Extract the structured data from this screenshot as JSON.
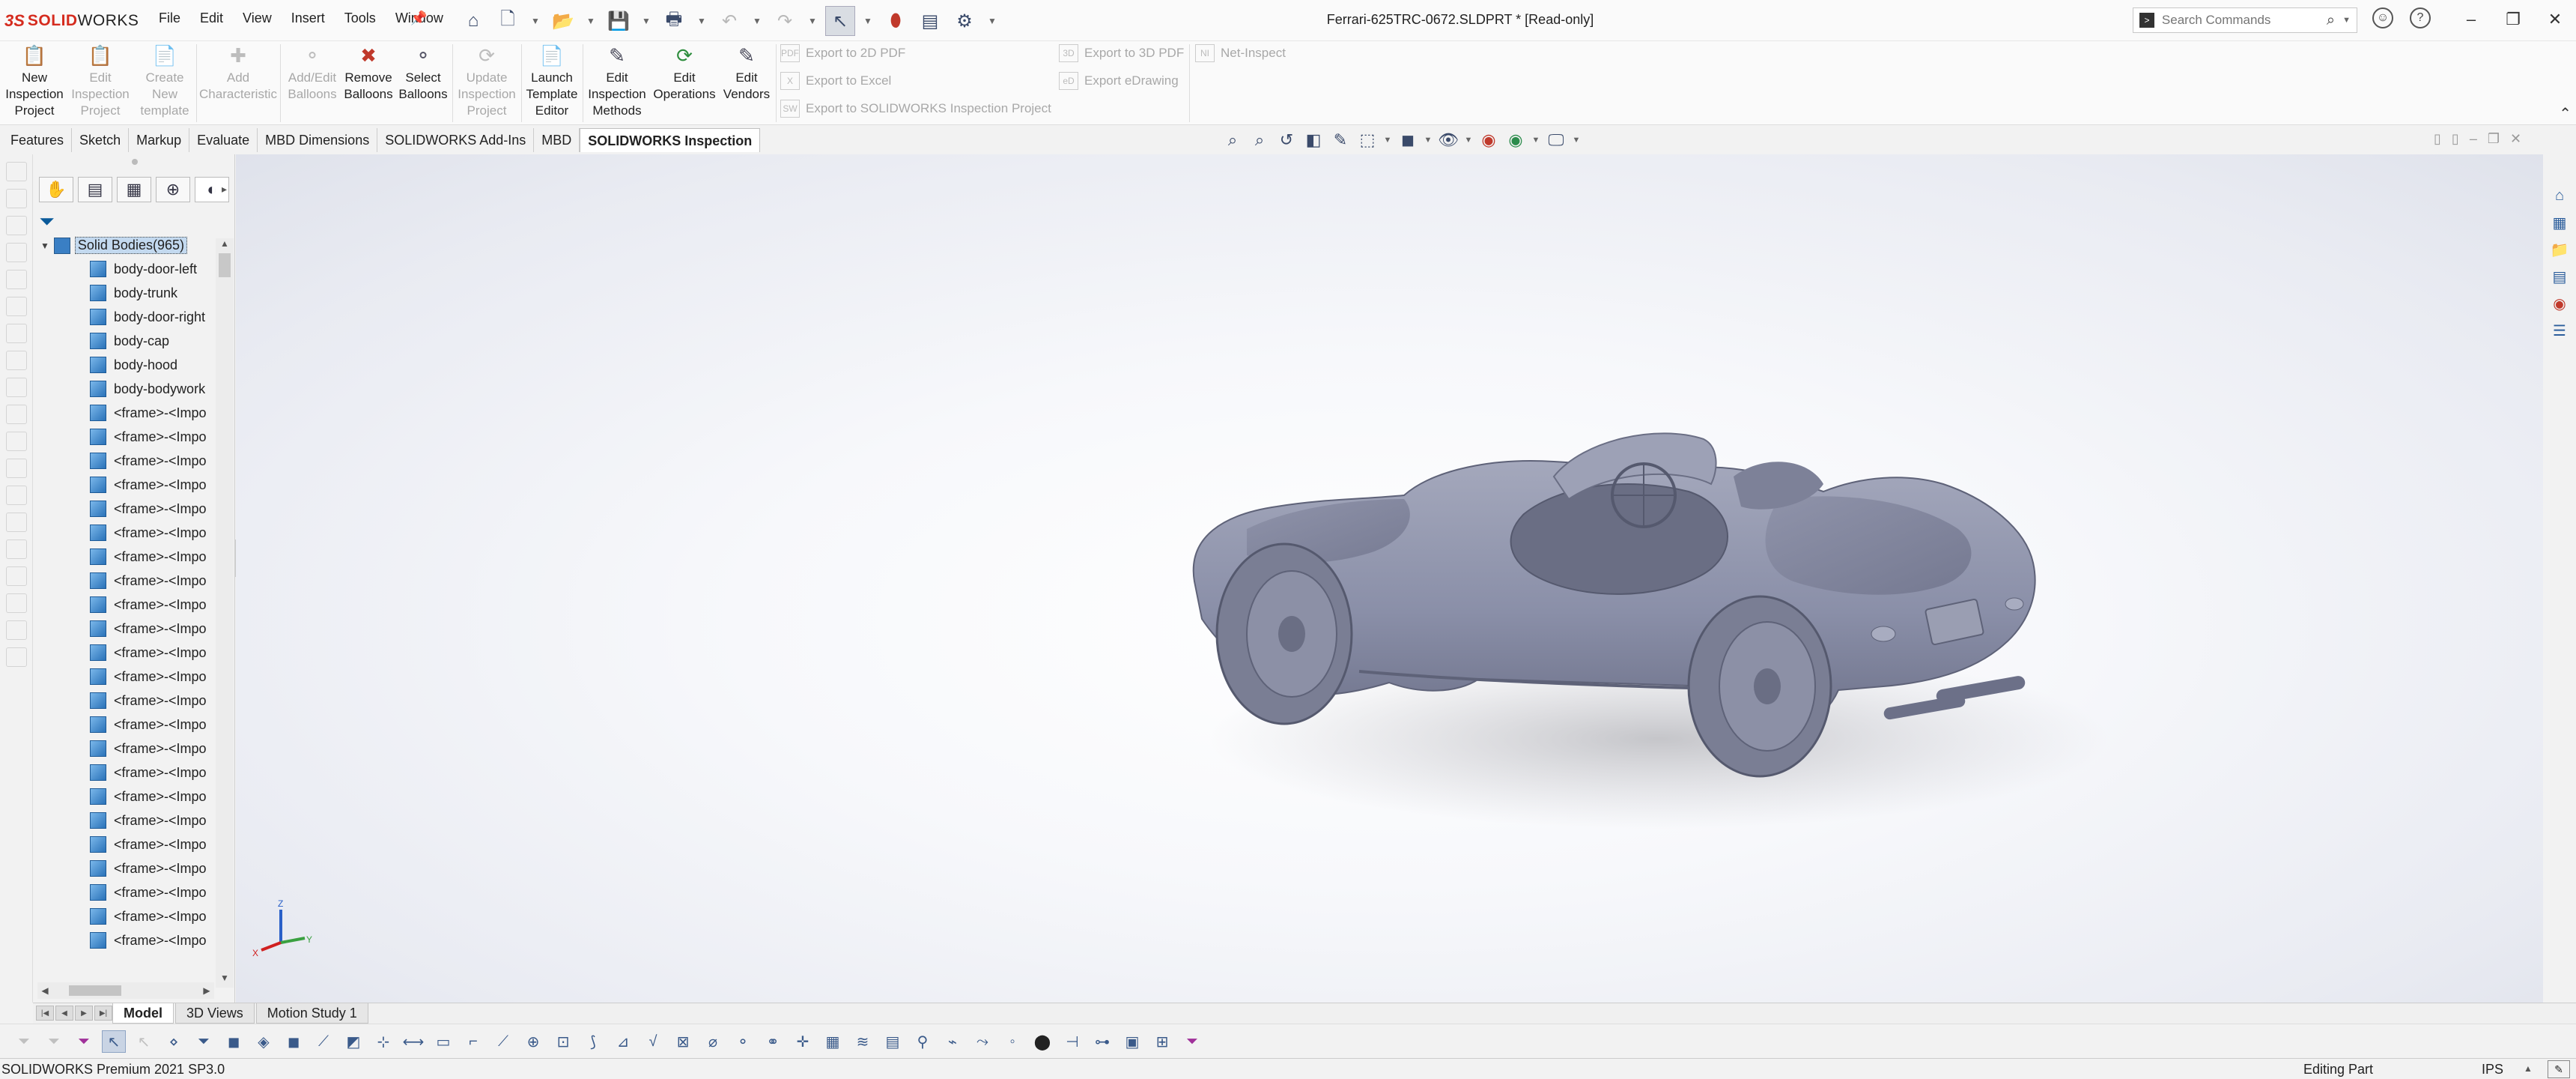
{
  "app": {
    "logo_ds": "3S",
    "logo_solid": "SOLID",
    "logo_works": "WORKS",
    "document_title": "Ferrari-625TRC-0672.SLDPRT * [Read-only]"
  },
  "menu": [
    "File",
    "Edit",
    "View",
    "Insert",
    "Tools",
    "Window"
  ],
  "search": {
    "placeholder": "Search Commands"
  },
  "ribbon": {
    "buttons": [
      {
        "label": "New Inspection Project",
        "enabled": true
      },
      {
        "label": "Edit Inspection Project",
        "enabled": false
      },
      {
        "label": "Create New template",
        "enabled": false
      },
      {
        "label": "Add Characteristic",
        "enabled": false
      },
      {
        "label": "Add/Edit Balloons",
        "enabled": false
      },
      {
        "label": "Remove Balloons",
        "enabled": true
      },
      {
        "label": "Select Balloons",
        "enabled": true
      },
      {
        "label": "Update Inspection Project",
        "enabled": false
      },
      {
        "label": "Launch Template Editor",
        "enabled": true
      },
      {
        "label": "Edit Inspection Methods",
        "enabled": true
      },
      {
        "label": "Edit Operations",
        "enabled": true
      },
      {
        "label": "Edit Vendors",
        "enabled": true
      }
    ],
    "exports": {
      "pdf2d": "Export to 2D PDF",
      "excel": "Export to Excel",
      "sw_inspection": "Export to SOLIDWORKS Inspection Project",
      "pdf3d": "Export to 3D PDF",
      "edrawing": "Export eDrawing",
      "net_inspect": "Net-Inspect"
    }
  },
  "command_tabs": [
    {
      "label": "Features",
      "active": false
    },
    {
      "label": "Sketch",
      "active": false
    },
    {
      "label": "Markup",
      "active": false
    },
    {
      "label": "Evaluate",
      "active": false
    },
    {
      "label": "MBD Dimensions",
      "active": false
    },
    {
      "label": "SOLIDWORKS Add-Ins",
      "active": false
    },
    {
      "label": "MBD",
      "active": false
    },
    {
      "label": "SOLIDWORKS Inspection",
      "active": true
    }
  ],
  "feature_tree": {
    "root_label": "Solid Bodies(965)",
    "items": [
      "body-door-left",
      "body-trunk",
      "body-door-right",
      "body-cap",
      "body-hood",
      "body-bodywork",
      "<frame>-<Impo",
      "<frame>-<Impo",
      "<frame>-<Impo",
      "<frame>-<Impo",
      "<frame>-<Impo",
      "<frame>-<Impo",
      "<frame>-<Impo",
      "<frame>-<Impo",
      "<frame>-<Impo",
      "<frame>-<Impo",
      "<frame>-<Impo",
      "<frame>-<Impo",
      "<frame>-<Impo",
      "<frame>-<Impo",
      "<frame>-<Impo",
      "<frame>-<Impo",
      "<frame>-<Impo",
      "<frame>-<Impo",
      "<frame>-<Impo",
      "<frame>-<Impo",
      "<frame>-<Impo",
      "<frame>-<Impo",
      "<frame>-<Impo",
      "<frame>-<Impo"
    ]
  },
  "triad": {
    "x": "X",
    "y": "Y",
    "z": "Z"
  },
  "model_tabs": [
    {
      "label": "Model",
      "active": true
    },
    {
      "label": "3D Views",
      "active": false
    },
    {
      "label": "Motion Study 1",
      "active": false
    }
  ],
  "status": {
    "product": "SOLIDWORKS Premium 2021 SP3.0",
    "mode": "Editing Part",
    "units": "IPS"
  },
  "colors": {
    "brand_red": "#d52b1e",
    "model_gray": "#8a8fa8",
    "tree_icon_blue": "#2a72b8"
  }
}
